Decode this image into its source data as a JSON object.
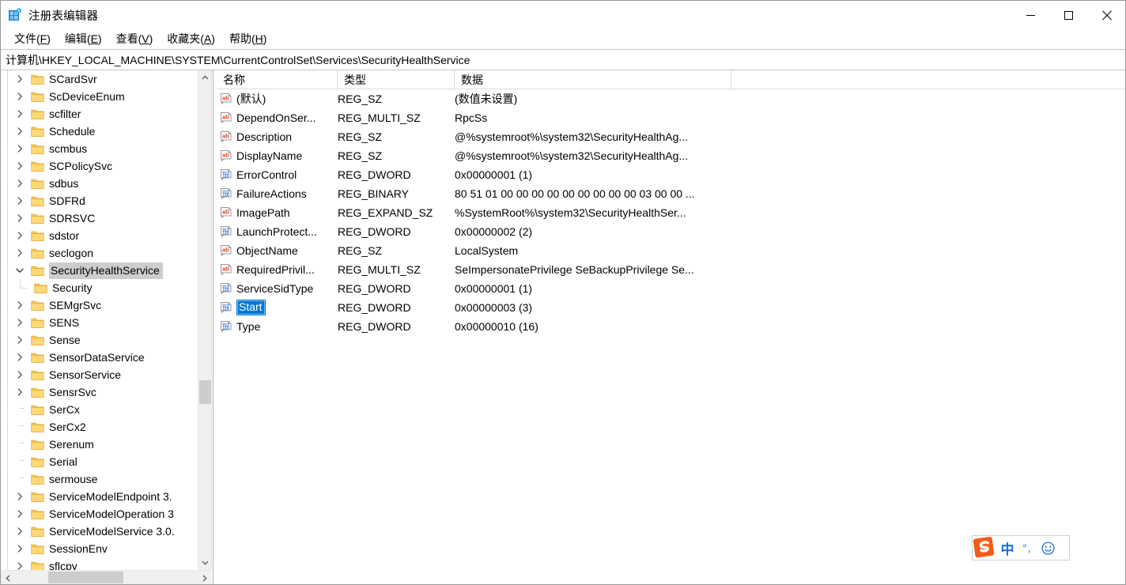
{
  "window": {
    "title": "注册表编辑器",
    "icon": "registry-editor-icon",
    "controls": {
      "minimize": "最小化",
      "maximize": "最大化",
      "close": "关闭"
    }
  },
  "menubar": {
    "items": [
      {
        "label": "文件(F)",
        "text": "文件(",
        "accel": "F",
        "tail": ")"
      },
      {
        "label": "编辑(E)",
        "text": "编辑(",
        "accel": "E",
        "tail": ")"
      },
      {
        "label": "查看(V)",
        "text": "查看(",
        "accel": "V",
        "tail": ")"
      },
      {
        "label": "收藏夹(A)",
        "text": "收藏夹(",
        "accel": "A",
        "tail": ")"
      },
      {
        "label": "帮助(H)",
        "text": "帮助(",
        "accel": "H",
        "tail": ")"
      }
    ]
  },
  "address": {
    "path": "计算机\\HKEY_LOCAL_MACHINE\\SYSTEM\\CurrentControlSet\\Services\\SecurityHealthService"
  },
  "tree": {
    "items": [
      {
        "label": "SCardSvr",
        "depth": 1,
        "expandable": true,
        "expanded": false,
        "selected": false
      },
      {
        "label": "ScDeviceEnum",
        "depth": 1,
        "expandable": true,
        "expanded": false,
        "selected": false
      },
      {
        "label": "scfilter",
        "depth": 1,
        "expandable": true,
        "expanded": false,
        "selected": false
      },
      {
        "label": "Schedule",
        "depth": 1,
        "expandable": true,
        "expanded": false,
        "selected": false
      },
      {
        "label": "scmbus",
        "depth": 1,
        "expandable": true,
        "expanded": false,
        "selected": false
      },
      {
        "label": "SCPolicySvc",
        "depth": 1,
        "expandable": true,
        "expanded": false,
        "selected": false
      },
      {
        "label": "sdbus",
        "depth": 1,
        "expandable": true,
        "expanded": false,
        "selected": false
      },
      {
        "label": "SDFRd",
        "depth": 1,
        "expandable": true,
        "expanded": false,
        "selected": false
      },
      {
        "label": "SDRSVC",
        "depth": 1,
        "expandable": true,
        "expanded": false,
        "selected": false
      },
      {
        "label": "sdstor",
        "depth": 1,
        "expandable": true,
        "expanded": false,
        "selected": false
      },
      {
        "label": "seclogon",
        "depth": 1,
        "expandable": true,
        "expanded": false,
        "selected": false
      },
      {
        "label": "SecurityHealthService",
        "depth": 1,
        "expandable": true,
        "expanded": true,
        "selected": true
      },
      {
        "label": "Security",
        "depth": 2,
        "expandable": false,
        "expanded": false,
        "selected": false
      },
      {
        "label": "SEMgrSvc",
        "depth": 1,
        "expandable": true,
        "expanded": false,
        "selected": false
      },
      {
        "label": "SENS",
        "depth": 1,
        "expandable": true,
        "expanded": false,
        "selected": false
      },
      {
        "label": "Sense",
        "depth": 1,
        "expandable": true,
        "expanded": false,
        "selected": false
      },
      {
        "label": "SensorDataService",
        "depth": 1,
        "expandable": true,
        "expanded": false,
        "selected": false
      },
      {
        "label": "SensorService",
        "depth": 1,
        "expandable": true,
        "expanded": false,
        "selected": false
      },
      {
        "label": "SensrSvc",
        "depth": 1,
        "expandable": true,
        "expanded": false,
        "selected": false
      },
      {
        "label": "SerCx",
        "depth": 1,
        "expandable": false,
        "expanded": false,
        "selected": false
      },
      {
        "label": "SerCx2",
        "depth": 1,
        "expandable": false,
        "expanded": false,
        "selected": false
      },
      {
        "label": "Serenum",
        "depth": 1,
        "expandable": false,
        "expanded": false,
        "selected": false
      },
      {
        "label": "Serial",
        "depth": 1,
        "expandable": false,
        "expanded": false,
        "selected": false
      },
      {
        "label": "sermouse",
        "depth": 1,
        "expandable": false,
        "expanded": false,
        "selected": false
      },
      {
        "label": "ServiceModelEndpoint 3.",
        "depth": 1,
        "expandable": true,
        "expanded": false,
        "selected": false
      },
      {
        "label": "ServiceModelOperation 3",
        "depth": 1,
        "expandable": true,
        "expanded": false,
        "selected": false
      },
      {
        "label": "ServiceModelService 3.0.",
        "depth": 1,
        "expandable": true,
        "expanded": false,
        "selected": false
      },
      {
        "label": "SessionEnv",
        "depth": 1,
        "expandable": true,
        "expanded": false,
        "selected": false
      },
      {
        "label": "sflcpy",
        "depth": 1,
        "expandable": true,
        "expanded": false,
        "selected": false
      }
    ]
  },
  "list": {
    "columns": [
      "名称",
      "类型",
      "数据"
    ],
    "rows": [
      {
        "name": "(默认)",
        "type": "REG_SZ",
        "data": "(数值未设置)",
        "icon": "string-value-icon",
        "selected": false
      },
      {
        "name": "DependOnSer...",
        "type": "REG_MULTI_SZ",
        "data": "RpcSs",
        "icon": "string-value-icon",
        "selected": false
      },
      {
        "name": "Description",
        "type": "REG_SZ",
        "data": "@%systemroot%\\system32\\SecurityHealthAg...",
        "icon": "string-value-icon",
        "selected": false
      },
      {
        "name": "DisplayName",
        "type": "REG_SZ",
        "data": "@%systemroot%\\system32\\SecurityHealthAg...",
        "icon": "string-value-icon",
        "selected": false
      },
      {
        "name": "ErrorControl",
        "type": "REG_DWORD",
        "data": "0x00000001 (1)",
        "icon": "binary-value-icon",
        "selected": false
      },
      {
        "name": "FailureActions",
        "type": "REG_BINARY",
        "data": "80 51 01 00 00 00 00 00 00 00 00 00 03 00 00 ...",
        "icon": "binary-value-icon",
        "selected": false
      },
      {
        "name": "ImagePath",
        "type": "REG_EXPAND_SZ",
        "data": "%SystemRoot%\\system32\\SecurityHealthSer...",
        "icon": "string-value-icon",
        "selected": false
      },
      {
        "name": "LaunchProtect...",
        "type": "REG_DWORD",
        "data": "0x00000002 (2)",
        "icon": "binary-value-icon",
        "selected": false
      },
      {
        "name": "ObjectName",
        "type": "REG_SZ",
        "data": "LocalSystem",
        "icon": "string-value-icon",
        "selected": false
      },
      {
        "name": "RequiredPrivil...",
        "type": "REG_MULTI_SZ",
        "data": "SeImpersonatePrivilege SeBackupPrivilege Se...",
        "icon": "string-value-icon",
        "selected": false
      },
      {
        "name": "ServiceSidType",
        "type": "REG_DWORD",
        "data": "0x00000001 (1)",
        "icon": "binary-value-icon",
        "selected": false
      },
      {
        "name": "Start",
        "type": "REG_DWORD",
        "data": "0x00000003 (3)",
        "icon": "binary-value-icon",
        "selected": true
      },
      {
        "name": "Type",
        "type": "REG_DWORD",
        "data": "0x00000010 (16)",
        "icon": "binary-value-icon",
        "selected": false
      }
    ]
  },
  "ime": {
    "logo": "sogou-logo-icon",
    "mode": "中",
    "punctuation": "°,",
    "smiley": "☺"
  },
  "colors": {
    "selection_blue": "#0078d7",
    "tree_selection_gray": "#cdcdcd",
    "folder_yellow": "#ffce5c",
    "string_icon_red": "#d94a2b",
    "binary_icon_blue": "#2b6fd9",
    "ime_orange": "#f25c19",
    "ime_blue": "#1a6fd4"
  }
}
